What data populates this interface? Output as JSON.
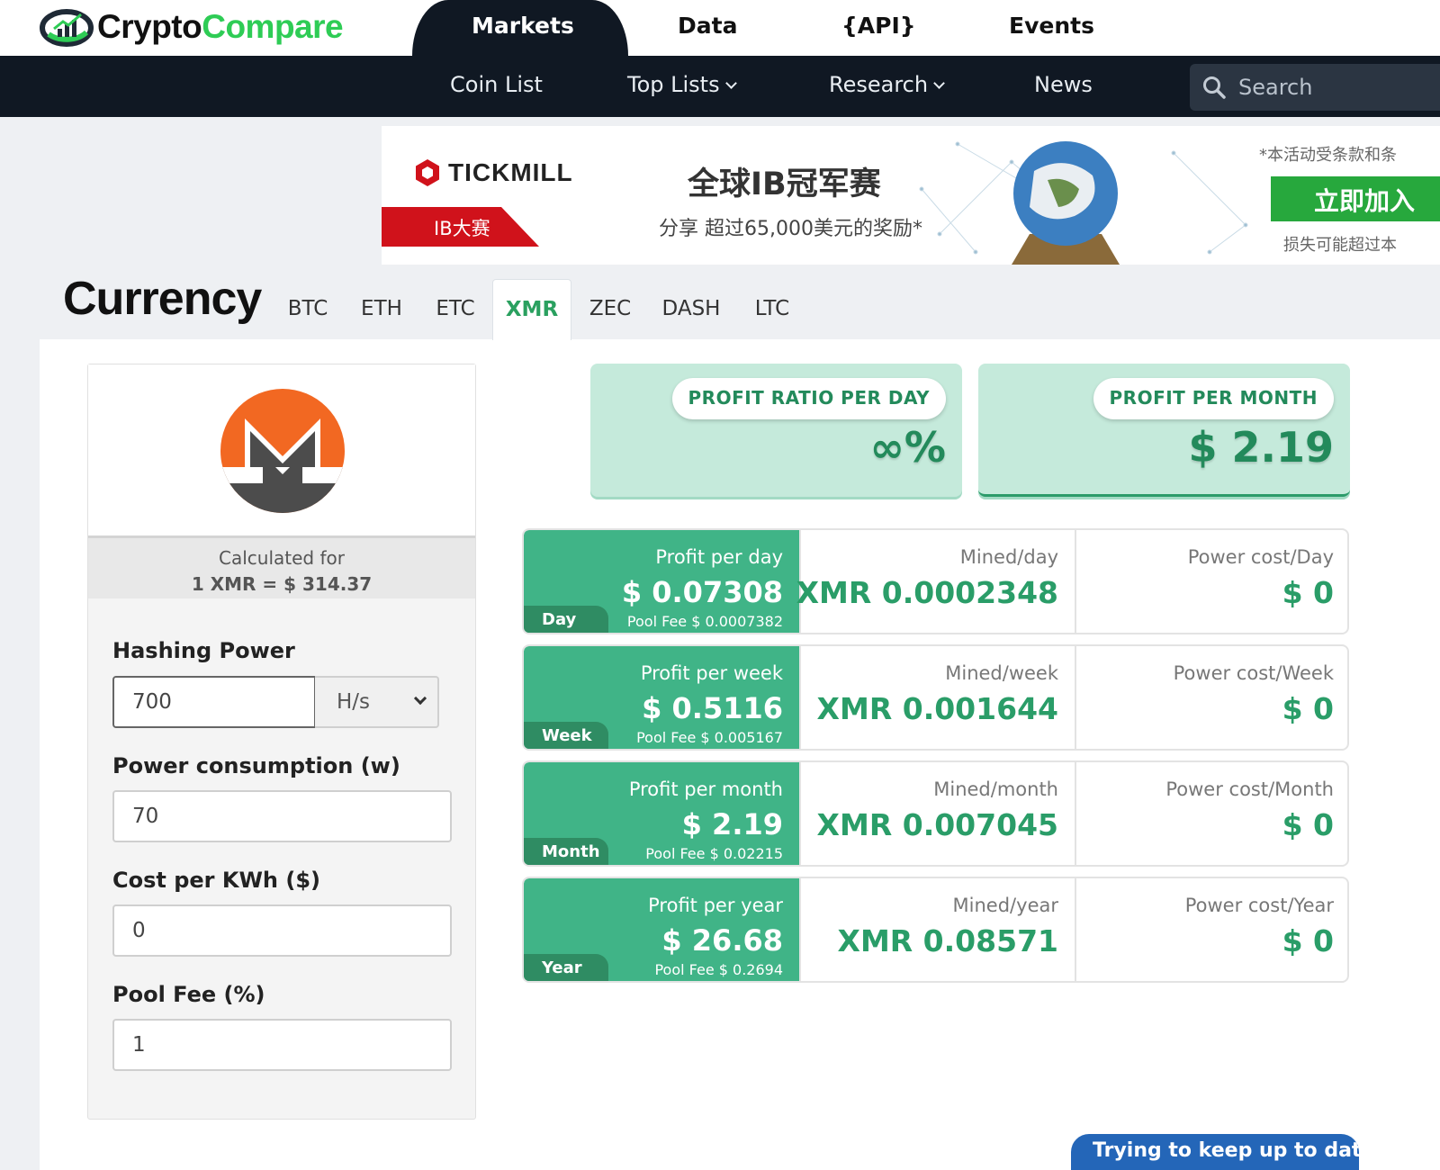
{
  "brand": {
    "part1": "Crypto",
    "part2": "Compare"
  },
  "main_nav": [
    "Markets",
    "Data",
    "{API}",
    "Events"
  ],
  "sub_nav": {
    "coin_list": "Coin List",
    "top_lists": "Top Lists",
    "research": "Research",
    "news": "News"
  },
  "search": {
    "placeholder": "Search"
  },
  "ad": {
    "brand": "TICKMILL",
    "tag": "IB大赛",
    "title": "全球IB冠军赛",
    "subtitle": "分享 超过65,000美元的奖励*",
    "note": "*本活动受条款和条",
    "cta": "立即加入",
    "risk": "损失可能超过本"
  },
  "currency": {
    "title": "Currency",
    "tabs": [
      "BTC",
      "ETH",
      "ETC",
      "XMR",
      "ZEC",
      "DASH",
      "LTC"
    ],
    "active_tab": "XMR"
  },
  "calculator": {
    "calc_for_label": "Calculated for",
    "rate": "1 XMR = $ 314.37",
    "hashing_power_label": "Hashing Power",
    "hashing_power_value": "700",
    "hashing_unit": "H/s",
    "power_label": "Power consumption (w)",
    "power_value": "70",
    "cost_label": "Cost per KWh ($)",
    "cost_value": "0",
    "pool_fee_label": "Pool Fee (%)",
    "pool_fee_value": "1"
  },
  "summary": {
    "ratio_label": "PROFIT RATIO PER DAY",
    "ratio_value": "∞%",
    "month_label": "PROFIT PER MONTH",
    "month_value": "$ 2.19"
  },
  "rows": [
    {
      "period": "Day",
      "profit_label": "Profit per day",
      "profit": "$ 0.07308",
      "pool_fee": "Pool Fee $ 0.0007382",
      "mined_label": "Mined/day",
      "mined": "XMR 0.0002348",
      "power_label": "Power cost/Day",
      "power": "$ 0"
    },
    {
      "period": "Week",
      "profit_label": "Profit per week",
      "profit": "$ 0.5116",
      "pool_fee": "Pool Fee $ 0.005167",
      "mined_label": "Mined/week",
      "mined": "XMR 0.001644",
      "power_label": "Power cost/Week",
      "power": "$ 0"
    },
    {
      "period": "Month",
      "profit_label": "Profit per month",
      "profit": "$ 2.19",
      "pool_fee": "Pool Fee $ 0.02215",
      "mined_label": "Mined/month",
      "mined": "XMR 0.007045",
      "power_label": "Power cost/Month",
      "power": "$ 0"
    },
    {
      "period": "Year",
      "profit_label": "Profit per year",
      "profit": "$ 26.68",
      "pool_fee": "Pool Fee $ 0.2694",
      "mined_label": "Mined/year",
      "mined": "XMR 0.08571",
      "power_label": "Power cost/Year",
      "power": "$ 0"
    }
  ],
  "footer_button": "Trying to keep up to date?",
  "colors": {
    "accent_green": "#40b487",
    "dark_navy": "#101823",
    "monero_orange": "#f26822",
    "brand_green": "#2ecc55"
  },
  "icons": {
    "logo": "chart-logo-icon",
    "search": "search-icon",
    "coin": "monero-icon"
  }
}
